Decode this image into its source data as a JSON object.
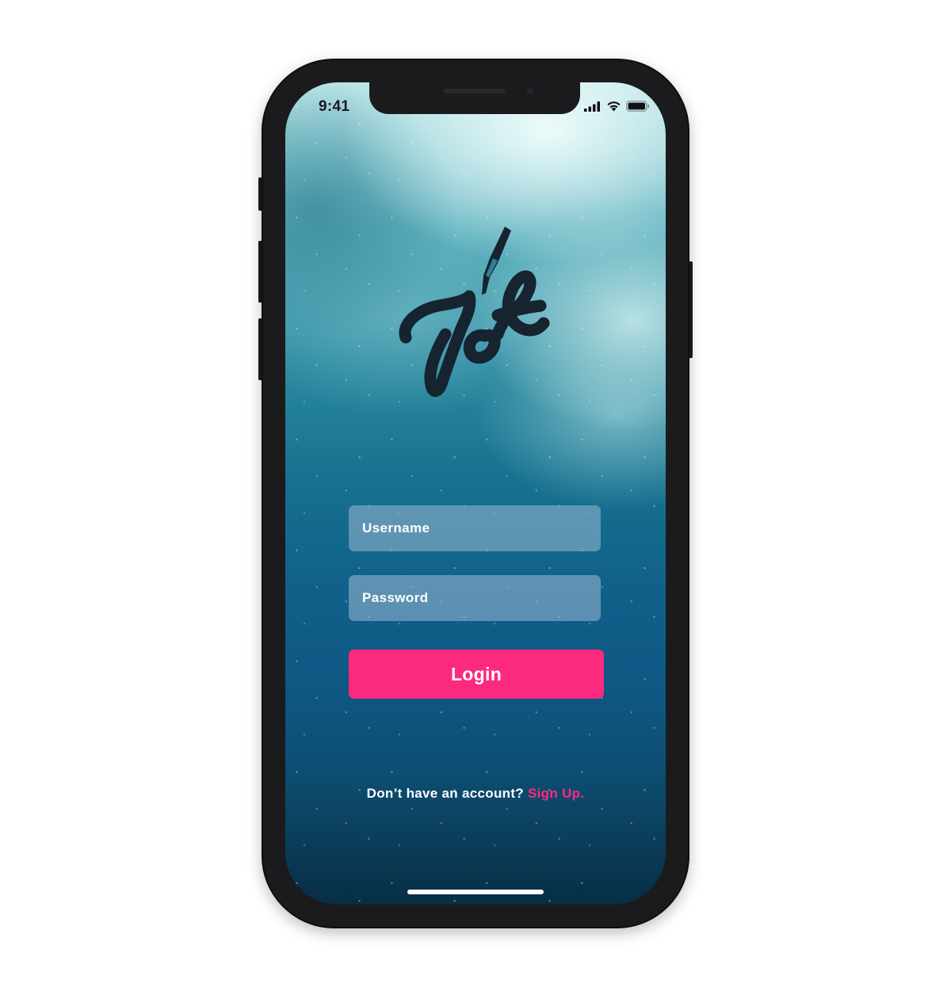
{
  "status_bar": {
    "time": "9:41",
    "icons": [
      "cellular-signal-icon",
      "wifi-icon",
      "battery-icon"
    ]
  },
  "app": {
    "logo_text": "Jot",
    "logo_icon": "pen-nib-icon"
  },
  "login_form": {
    "username_placeholder": "Username",
    "password_placeholder": "Password",
    "login_label": "Login"
  },
  "signup": {
    "prompt": "Don’t have an account?",
    "link_label": "Sign Up."
  },
  "colors": {
    "accent": "#fb2a7e",
    "logo": "#15242f",
    "field_background": "#8cb0cc"
  }
}
